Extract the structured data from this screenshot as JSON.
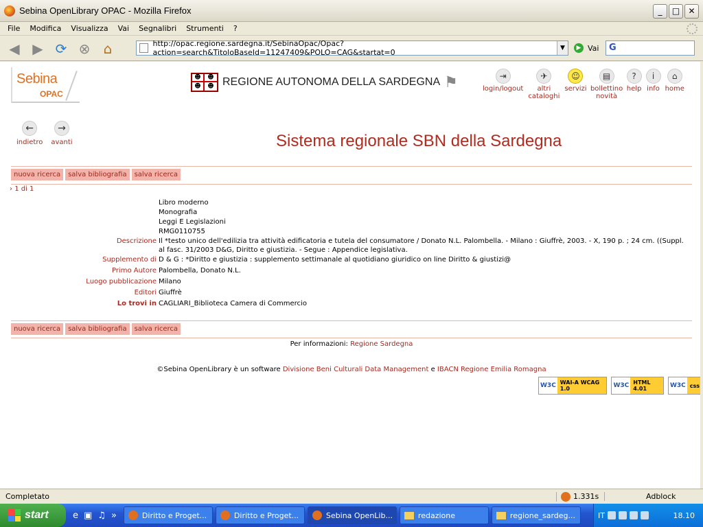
{
  "window": {
    "title": "Sebina OpenLibrary OPAC - Mozilla Firefox",
    "buttons": [
      "_",
      "□",
      "✕"
    ]
  },
  "menubar": [
    "File",
    "Modifica",
    "Visualizza",
    "Vai",
    "Segnalibri",
    "Strumenti",
    "?"
  ],
  "navbar": {
    "url": "http://opac.regione.sardegna.it/SebinaOpac/Opac?action=search&TitoloBaseId=11247409&POLO=CAG&startat=0",
    "go_label": "Vai",
    "search_value": "G"
  },
  "header": {
    "logo_top": "Sebina",
    "logo_bottom": "OPAC",
    "region_name": "REGIONE AUTONOMA DELLA SARDEGNA",
    "tools": [
      {
        "label": "login/logout",
        "icon": "login-icon"
      },
      {
        "label": "altri cataloghi",
        "icon": "catalogs-icon"
      },
      {
        "label": "servizi",
        "icon": "smile-icon"
      },
      {
        "label": "bollettino novità",
        "icon": "bulletin-icon"
      },
      {
        "label": "help",
        "icon": "help-icon"
      },
      {
        "label": "info",
        "icon": "info-icon"
      },
      {
        "label": "home",
        "icon": "home-icon"
      }
    ],
    "back": "indietro",
    "forward": "avanti",
    "page_title": "Sistema regionale SBN della Sardegna"
  },
  "actions": [
    "nuova ricerca",
    "salva bibliografia",
    "salva ricerca"
  ],
  "result_count": "1 di 1",
  "record": {
    "lines": [
      "Libro moderno",
      "Monografia",
      "Leggi E Legislazioni",
      "RMG0110755"
    ],
    "fields": [
      {
        "label": "Descrizione",
        "value": "Il *testo unico dell'edilizia tra attività edificatoria e tutela del consumatore / Donato N.L. Palombella. - Milano : Giuffrè, 2003. - X, 190 p. ; 24 cm. ((Suppl. al fasc. 31/2003 D&G, Diritto e giustizia. - Segue : Appendice legislativa."
      },
      {
        "label": "Supplemento di",
        "value": "D & G : *Diritto e giustizia : supplemento settimanale al quotidiano giuridico on line Diritto & giustizi@"
      },
      {
        "label": "Primo Autore",
        "value": "Palombella, Donato N.L."
      },
      {
        "label": "Luogo pubblicazione",
        "value": "Milano"
      },
      {
        "label": "Editori",
        "value": "Giuffrè"
      },
      {
        "label": "Lo trovi in",
        "value": "CAGLIARI_Biblioteca Camera di Commercio"
      }
    ]
  },
  "footer": {
    "info_prefix": "Per informazioni:",
    "info_link": "Regione Sardegna",
    "copy_prefix": "©Sebina OpenLibrary è un software",
    "copy_link1": "Divisione Beni Culturali Data Management",
    "copy_and": "e",
    "copy_link2": "IBACN Regione Emilia Romagna",
    "badges": [
      {
        "w": "W3C",
        "b": "WAI-A WCAG 1.0"
      },
      {
        "w": "W3C",
        "b": "HTML 4.01"
      },
      {
        "w": "W3C",
        "b": "css"
      }
    ]
  },
  "statusbar": {
    "status": "Completato",
    "time": "1.331s",
    "adblock": "Adblock"
  },
  "taskbar": {
    "start": "start",
    "tasks": [
      {
        "label": "Diritto e Proget...",
        "active": false
      },
      {
        "label": "Diritto e Proget...",
        "active": false
      },
      {
        "label": "Sebina OpenLib...",
        "active": true
      },
      {
        "label": "redazione",
        "active": false
      },
      {
        "label": "regione_sardeg...",
        "active": false
      }
    ],
    "lang": "IT",
    "clock": "18.10"
  }
}
